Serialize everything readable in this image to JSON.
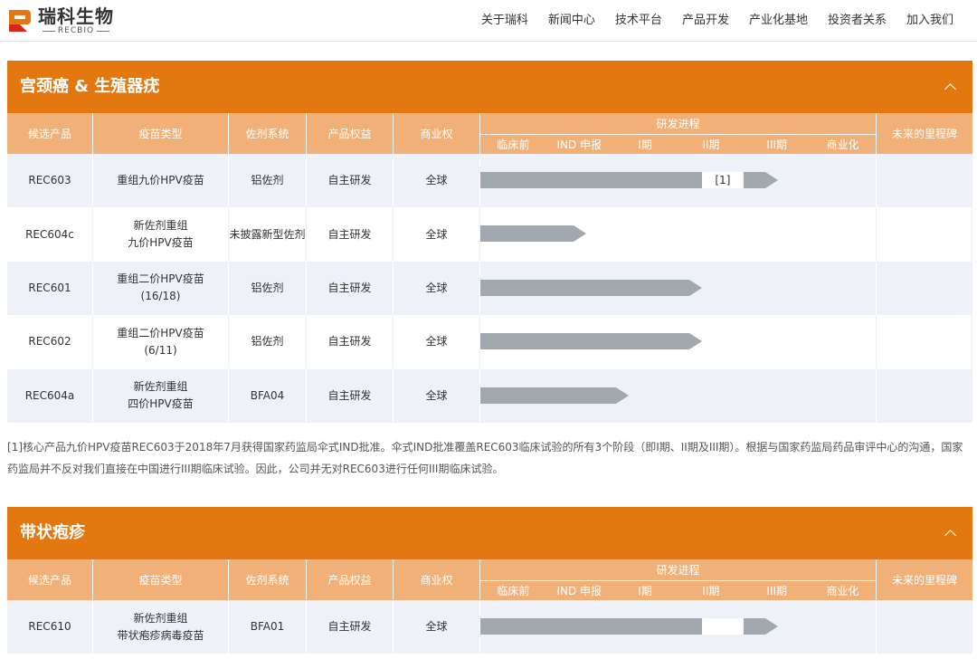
{
  "logo": {
    "cn": "瑞科生物",
    "en": "RECBIO"
  },
  "nav": [
    "关于瑞科",
    "新闻中心",
    "技术平台",
    "产品开发",
    "产业化基地",
    "投资者关系",
    "加入我们"
  ],
  "columns": {
    "candidate": "候选产品",
    "vaccine_type": "疫苗类型",
    "adjuvant": "佐剂系统",
    "rights": "产品权益",
    "commercial": "商业权",
    "progress": "研发进程",
    "milestone": "未来的里程碑",
    "stages": [
      "临床前",
      "IND 申报",
      "I期",
      "II期",
      "III期",
      "商业化"
    ]
  },
  "sections": [
    {
      "title": "宫颈癌 & 生殖器疣",
      "rows": [
        {
          "candidate": "REC603",
          "type_lines": [
            "重组九价HPV疫苗"
          ],
          "adjuvant": "铝佐剂",
          "rights": "自主研发",
          "commercial": "全球",
          "progress_end": 4.5,
          "gap_from": 3.36,
          "gap_to": 4.5,
          "gap_label": "[1]"
        },
        {
          "candidate": "REC604c",
          "type_lines": [
            "新佐剂重组",
            "九价HPV疫苗"
          ],
          "adjuvant": "未披露新型佐剂",
          "rights": "自主研发",
          "commercial": "全球",
          "progress_end": 1.6,
          "gap_label": ""
        },
        {
          "candidate": "REC601",
          "type_lines": [
            "重组二价HPV疫苗",
            "(16/18)"
          ],
          "adjuvant": "铝佐剂",
          "rights": "自主研发",
          "commercial": "全球",
          "progress_end": 3.35,
          "gap_label": ""
        },
        {
          "candidate": "REC602",
          "type_lines": [
            "重组二价HPV疫苗",
            "(6/11)"
          ],
          "adjuvant": "铝佐剂",
          "rights": "自主研发",
          "commercial": "全球",
          "progress_end": 3.35,
          "gap_label": ""
        },
        {
          "candidate": "REC604a",
          "type_lines": [
            "新佐剂重组",
            "四价HPV疫苗"
          ],
          "adjuvant": "BFA04",
          "rights": "自主研发",
          "commercial": "全球",
          "progress_end": 2.25,
          "gap_label": ""
        }
      ]
    },
    {
      "title": "带状疱疹",
      "rows": [
        {
          "candidate": "REC610",
          "type_lines": [
            "新佐剂重组",
            "带状疱疹病毒疫苗"
          ],
          "adjuvant": "BFA01",
          "rights": "自主研发",
          "commercial": "全球",
          "progress_end": 4.5,
          "gap_from": 3.36,
          "gap_to": 4.5,
          "gap_label": ""
        }
      ]
    }
  ],
  "footnote": "[1]核心产品九价HPV疫苗REC603于2018年7月获得国家药监局伞式IND批准。伞式IND批准覆盖REC603临床试验的所有3个阶段（即I期、II期及III期）。根据与国家药监局药品审评中心的沟通，国家药监局并不反对我们直接在中国进行III期临床试验。因此，公司并无对REC603进行任何III期临床试验。",
  "colors": {
    "accent": "#e2780f",
    "header_light": "#f0b077",
    "bar": "#a2a9ae",
    "row_alt": "#eef1f7"
  }
}
